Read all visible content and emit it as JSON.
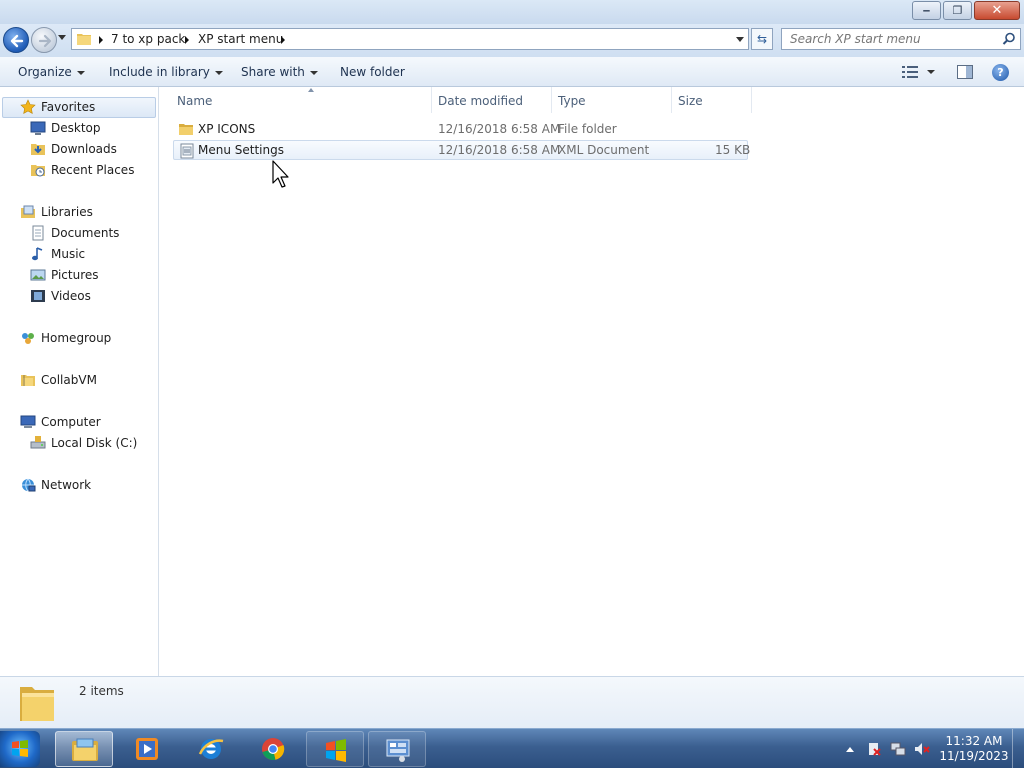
{
  "window": {
    "controls": {
      "minimize": "minimize",
      "maximize": "maximize",
      "close": "close"
    }
  },
  "address": {
    "crumbs": [
      "7 to xp pack",
      "XP start menu"
    ]
  },
  "search": {
    "placeholder": "Search XP start menu"
  },
  "toolbar": {
    "organize": "Organize",
    "include": "Include in library",
    "share": "Share with",
    "new_folder": "New folder"
  },
  "nav": {
    "favorites": "Favorites",
    "desktop": "Desktop",
    "downloads": "Downloads",
    "recent": "Recent Places",
    "libraries": "Libraries",
    "documents": "Documents",
    "music": "Music",
    "pictures": "Pictures",
    "videos": "Videos",
    "homegroup": "Homegroup",
    "collabvm": "CollabVM",
    "computer": "Computer",
    "localdisk": "Local Disk (C:)",
    "network": "Network"
  },
  "columns": {
    "name": "Name",
    "date": "Date modified",
    "type": "Type",
    "size": "Size"
  },
  "files": [
    {
      "name": "XP ICONS",
      "date": "12/16/2018 6:58 AM",
      "type": "File folder",
      "size": "",
      "icon": "folder-icon"
    },
    {
      "name": "Menu Settings",
      "date": "12/16/2018 6:58 AM",
      "type": "XML Document",
      "size": "15 KB",
      "icon": "xml-file-icon"
    }
  ],
  "status": {
    "count": "2 items"
  },
  "clock": {
    "time": "11:32 AM",
    "date": "11/19/2023"
  },
  "colors": {
    "taskbar": "#3b5f90",
    "selection": "#e8f0fa",
    "link": "#1e3250"
  }
}
